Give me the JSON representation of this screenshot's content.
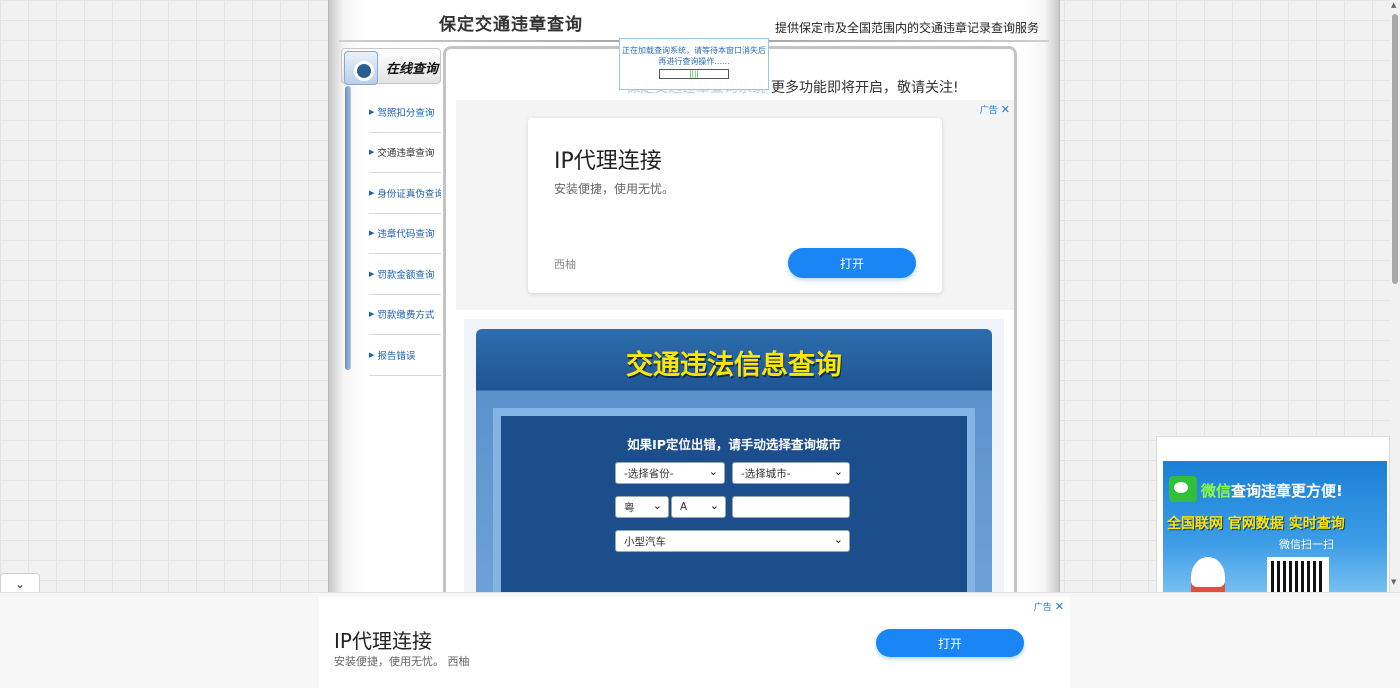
{
  "header": {
    "title": "保定交通违章查询",
    "subtitle": "提供保定市及全国范围内的交通违章记录查询服务"
  },
  "sidebar": {
    "title": "在线查询",
    "items": [
      {
        "label": "驾照扣分查询"
      },
      {
        "label": "交通违章查询"
      },
      {
        "label": "身份证真伪查询"
      },
      {
        "label": "违章代码查询"
      },
      {
        "label": "罚款金额查询"
      },
      {
        "label": "罚款缴费方式"
      },
      {
        "label": "报告错误"
      }
    ]
  },
  "notice": {
    "faded": "保定交通违章查询系统",
    "text": "更多功能即将开启，敬请关注!"
  },
  "loading_popup": {
    "text": "正在加载查询系统，请等待本窗口消失后再进行查询操作......",
    "bar": "||||"
  },
  "ad_top": {
    "tag": "广告",
    "close": "✕",
    "title": "IP代理连接",
    "desc": "安装便捷，使用无忧。",
    "brand": "西柚",
    "button": "打开"
  },
  "query": {
    "title": "交通违法信息查询",
    "prompt": "如果IP定位出错，请手动选择查询城市",
    "province_placeholder": "-选择省份-",
    "city_placeholder": "-选择城市-",
    "plate_prefix": "粤",
    "plate_letter": "A",
    "plate_number": "",
    "vehicle_type": "小型汽车"
  },
  "right_ad": {
    "line1_highlight": "微信",
    "line1_rest": "查询违章更方便!",
    "line2": "全国联网 官网数据 实时查询",
    "line3": "微信扫一扫"
  },
  "bottom_ad": {
    "tag": "广告",
    "close": "✕",
    "title": "IP代理连接",
    "desc": "安装便捷，使用无忧。 西柚",
    "button": "打开"
  },
  "collapse_button": "⌄",
  "colors": {
    "link_blue": "#1a5fb4",
    "query_title_yellow": "#ffe600",
    "button_blue": "#1a86f5"
  }
}
